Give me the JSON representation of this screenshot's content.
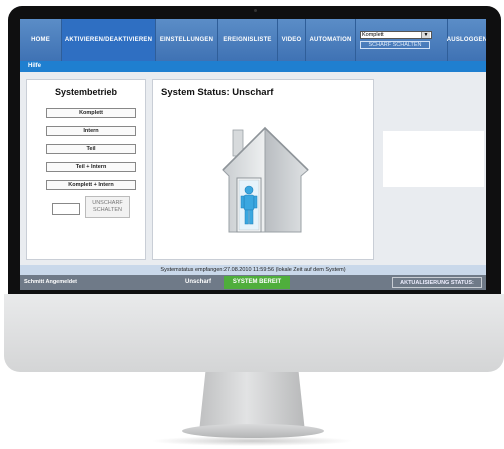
{
  "nav": {
    "items": [
      {
        "label": "HOME",
        "active": false
      },
      {
        "label": "AKTIVIEREN/DEAKTIVIEREN",
        "active": true
      },
      {
        "label": "EINSTELLUNGEN",
        "active": false
      },
      {
        "label": "EREIGNISLISTE",
        "active": false
      },
      {
        "label": "VIDEO",
        "active": false
      },
      {
        "label": "AUTOMATION",
        "active": false
      }
    ],
    "mode_select_value": "Komplett",
    "arm_button": "SCHARF SCHALTEN",
    "logout": "AUSLOGGEN"
  },
  "subbar": {
    "help": "Hilfe"
  },
  "left_panel": {
    "title": "Systembetrieb",
    "buttons": [
      "Komplett",
      "Intern",
      "Teil",
      "Teil + Intern",
      "Komplett + Intern"
    ],
    "disarm_line1": "UNSCHARF",
    "disarm_line2": "SCHALTEN"
  },
  "center_panel": {
    "title": "System Status: Unscharf"
  },
  "status_line": "Systemstatus empfangen:27.08.2010 11:59:56 (lokale Zeit auf dem System)",
  "bottom": {
    "user": "Schmitt Angemeldet",
    "state": "Unscharf",
    "ready": "SYSTEM BEREIT",
    "update": "AKTUALISIERUNG STATUS:"
  },
  "colors": {
    "nav": "#3f72b4",
    "nav_active": "#2f6fc2",
    "subbar": "#1f7fd0",
    "ready": "#4fae3c",
    "bottombar": "#6f7a88"
  }
}
